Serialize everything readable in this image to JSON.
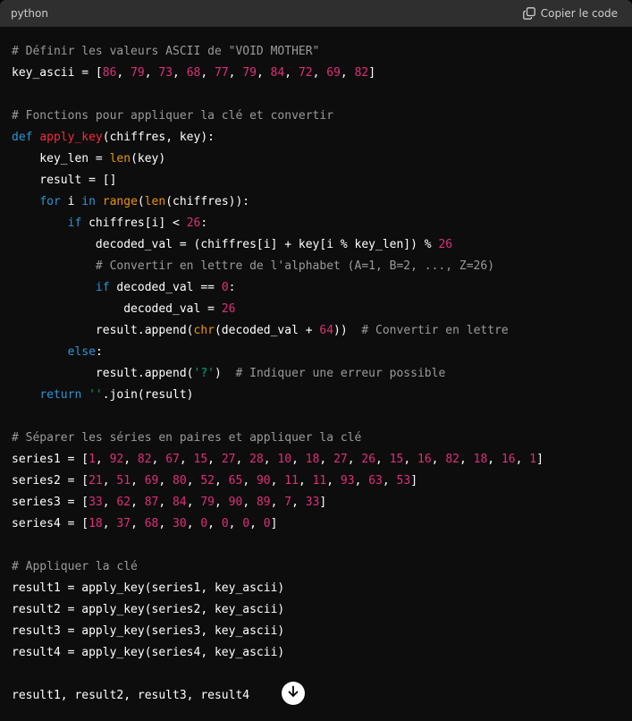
{
  "header": {
    "language": "python",
    "copy_label": "Copier le code",
    "copy_icon": "copy-icon"
  },
  "code": {
    "lines": [
      [
        [
          "comment",
          "# Définir les valeurs ASCII de \"VOID MOTHER\""
        ]
      ],
      [
        [
          "plain",
          "key_ascii = ["
        ],
        [
          "num",
          "86"
        ],
        [
          "plain",
          ", "
        ],
        [
          "num",
          "79"
        ],
        [
          "plain",
          ", "
        ],
        [
          "num",
          "73"
        ],
        [
          "plain",
          ", "
        ],
        [
          "num",
          "68"
        ],
        [
          "plain",
          ", "
        ],
        [
          "num",
          "77"
        ],
        [
          "plain",
          ", "
        ],
        [
          "num",
          "79"
        ],
        [
          "plain",
          ", "
        ],
        [
          "num",
          "84"
        ],
        [
          "plain",
          ", "
        ],
        [
          "num",
          "72"
        ],
        [
          "plain",
          ", "
        ],
        [
          "num",
          "69"
        ],
        [
          "plain",
          ", "
        ],
        [
          "num",
          "82"
        ],
        [
          "plain",
          "]"
        ]
      ],
      [],
      [
        [
          "comment",
          "# Fonctions pour appliquer la clé et convertir"
        ]
      ],
      [
        [
          "kw",
          "def"
        ],
        [
          "plain",
          " "
        ],
        [
          "fn",
          "apply_key"
        ],
        [
          "plain",
          "(chiffres, key):"
        ]
      ],
      [
        [
          "plain",
          "    key_len = "
        ],
        [
          "bi",
          "len"
        ],
        [
          "plain",
          "(key)"
        ]
      ],
      [
        [
          "plain",
          "    result = []"
        ]
      ],
      [
        [
          "plain",
          "    "
        ],
        [
          "kw",
          "for"
        ],
        [
          "plain",
          " i "
        ],
        [
          "kw",
          "in"
        ],
        [
          "plain",
          " "
        ],
        [
          "bi",
          "range"
        ],
        [
          "plain",
          "("
        ],
        [
          "bi",
          "len"
        ],
        [
          "plain",
          "(chiffres)):"
        ]
      ],
      [
        [
          "plain",
          "        "
        ],
        [
          "kw",
          "if"
        ],
        [
          "plain",
          " chiffres[i] < "
        ],
        [
          "num",
          "26"
        ],
        [
          "plain",
          ":"
        ]
      ],
      [
        [
          "plain",
          "            decoded_val = (chiffres[i] + key[i % key_len]) % "
        ],
        [
          "num",
          "26"
        ]
      ],
      [
        [
          "plain",
          "            "
        ],
        [
          "comment",
          "# Convertir en lettre de l'alphabet (A=1, B=2, ..., Z=26)"
        ]
      ],
      [
        [
          "plain",
          "            "
        ],
        [
          "kw",
          "if"
        ],
        [
          "plain",
          " decoded_val == "
        ],
        [
          "num",
          "0"
        ],
        [
          "plain",
          ":"
        ]
      ],
      [
        [
          "plain",
          "                decoded_val = "
        ],
        [
          "num",
          "26"
        ]
      ],
      [
        [
          "plain",
          "            result.append("
        ],
        [
          "bi",
          "chr"
        ],
        [
          "plain",
          "(decoded_val + "
        ],
        [
          "num",
          "64"
        ],
        [
          "plain",
          "))  "
        ],
        [
          "comment",
          "# Convertir en lettre"
        ]
      ],
      [
        [
          "plain",
          "        "
        ],
        [
          "kw",
          "else"
        ],
        [
          "plain",
          ":"
        ]
      ],
      [
        [
          "plain",
          "            result.append("
        ],
        [
          "str",
          "'?'"
        ],
        [
          "plain",
          ")  "
        ],
        [
          "comment",
          "# Indiquer une erreur possible"
        ]
      ],
      [
        [
          "plain",
          "    "
        ],
        [
          "kw",
          "return"
        ],
        [
          "plain",
          " "
        ],
        [
          "str",
          "''"
        ],
        [
          "plain",
          ".join(result)"
        ]
      ],
      [],
      [
        [
          "comment",
          "# Séparer les séries en paires et appliquer la clé"
        ]
      ],
      [
        [
          "plain",
          "series1 = ["
        ],
        [
          "num",
          "1"
        ],
        [
          "plain",
          ", "
        ],
        [
          "num",
          "92"
        ],
        [
          "plain",
          ", "
        ],
        [
          "num",
          "82"
        ],
        [
          "plain",
          ", "
        ],
        [
          "num",
          "67"
        ],
        [
          "plain",
          ", "
        ],
        [
          "num",
          "15"
        ],
        [
          "plain",
          ", "
        ],
        [
          "num",
          "27"
        ],
        [
          "plain",
          ", "
        ],
        [
          "num",
          "28"
        ],
        [
          "plain",
          ", "
        ],
        [
          "num",
          "10"
        ],
        [
          "plain",
          ", "
        ],
        [
          "num",
          "18"
        ],
        [
          "plain",
          ", "
        ],
        [
          "num",
          "27"
        ],
        [
          "plain",
          ", "
        ],
        [
          "num",
          "26"
        ],
        [
          "plain",
          ", "
        ],
        [
          "num",
          "15"
        ],
        [
          "plain",
          ", "
        ],
        [
          "num",
          "16"
        ],
        [
          "plain",
          ", "
        ],
        [
          "num",
          "82"
        ],
        [
          "plain",
          ", "
        ],
        [
          "num",
          "18"
        ],
        [
          "plain",
          ", "
        ],
        [
          "num",
          "16"
        ],
        [
          "plain",
          ", "
        ],
        [
          "num",
          "1"
        ],
        [
          "plain",
          "]"
        ]
      ],
      [
        [
          "plain",
          "series2 = ["
        ],
        [
          "num",
          "21"
        ],
        [
          "plain",
          ", "
        ],
        [
          "num",
          "51"
        ],
        [
          "plain",
          ", "
        ],
        [
          "num",
          "69"
        ],
        [
          "plain",
          ", "
        ],
        [
          "num",
          "80"
        ],
        [
          "plain",
          ", "
        ],
        [
          "num",
          "52"
        ],
        [
          "plain",
          ", "
        ],
        [
          "num",
          "65"
        ],
        [
          "plain",
          ", "
        ],
        [
          "num",
          "90"
        ],
        [
          "plain",
          ", "
        ],
        [
          "num",
          "11"
        ],
        [
          "plain",
          ", "
        ],
        [
          "num",
          "11"
        ],
        [
          "plain",
          ", "
        ],
        [
          "num",
          "93"
        ],
        [
          "plain",
          ", "
        ],
        [
          "num",
          "63"
        ],
        [
          "plain",
          ", "
        ],
        [
          "num",
          "53"
        ],
        [
          "plain",
          "]"
        ]
      ],
      [
        [
          "plain",
          "series3 = ["
        ],
        [
          "num",
          "33"
        ],
        [
          "plain",
          ", "
        ],
        [
          "num",
          "62"
        ],
        [
          "plain",
          ", "
        ],
        [
          "num",
          "87"
        ],
        [
          "plain",
          ", "
        ],
        [
          "num",
          "84"
        ],
        [
          "plain",
          ", "
        ],
        [
          "num",
          "79"
        ],
        [
          "plain",
          ", "
        ],
        [
          "num",
          "90"
        ],
        [
          "plain",
          ", "
        ],
        [
          "num",
          "89"
        ],
        [
          "plain",
          ", "
        ],
        [
          "num",
          "7"
        ],
        [
          "plain",
          ", "
        ],
        [
          "num",
          "33"
        ],
        [
          "plain",
          "]"
        ]
      ],
      [
        [
          "plain",
          "series4 = ["
        ],
        [
          "num",
          "18"
        ],
        [
          "plain",
          ", "
        ],
        [
          "num",
          "37"
        ],
        [
          "plain",
          ", "
        ],
        [
          "num",
          "68"
        ],
        [
          "plain",
          ", "
        ],
        [
          "num",
          "30"
        ],
        [
          "plain",
          ", "
        ],
        [
          "num",
          "0"
        ],
        [
          "plain",
          ", "
        ],
        [
          "num",
          "0"
        ],
        [
          "plain",
          ", "
        ],
        [
          "num",
          "0"
        ],
        [
          "plain",
          ", "
        ],
        [
          "num",
          "0"
        ],
        [
          "plain",
          "]"
        ]
      ],
      [],
      [
        [
          "comment",
          "# Appliquer la clé"
        ]
      ],
      [
        [
          "plain",
          "result1 = apply_key(series1, key_ascii)"
        ]
      ],
      [
        [
          "plain",
          "result2 = apply_key(series2, key_ascii)"
        ]
      ],
      [
        [
          "plain",
          "result3 = apply_key(series3, key_ascii)"
        ]
      ],
      [
        [
          "plain",
          "result4 = apply_key(series4, key_ascii)"
        ]
      ],
      [],
      [
        [
          "plain",
          "result1, result2, result3, result4"
        ]
      ]
    ]
  },
  "scroll_button": {
    "icon": "arrow-down-icon"
  }
}
